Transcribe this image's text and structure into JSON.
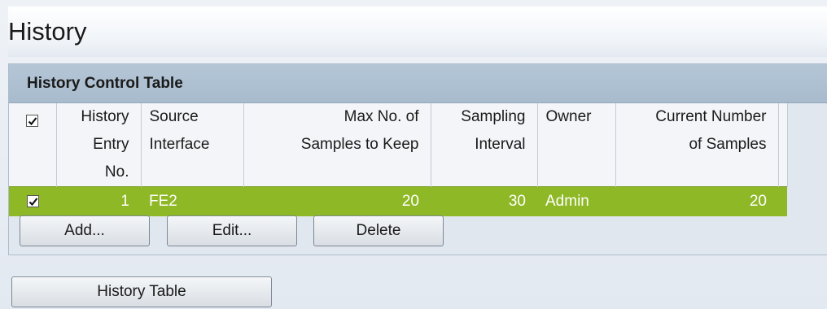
{
  "page": {
    "title": "History"
  },
  "panel": {
    "title": "History Control Table",
    "columns": [
      {
        "line1": "History",
        "line2": "Entry No."
      },
      {
        "line1": "Source",
        "line2": "Interface"
      },
      {
        "line1": "Max No. of",
        "line2": "Samples to Keep"
      },
      {
        "line1": "Sampling",
        "line2": "Interval"
      },
      {
        "line1": "Owner",
        "line2": ""
      },
      {
        "line1": "Current Number",
        "line2": "of Samples"
      }
    ],
    "header_checked": true,
    "rows": [
      {
        "checked": true,
        "entry_no": "1",
        "source_interface": "FE2",
        "max_samples": "20",
        "sampling_interval": "30",
        "owner": "Admin",
        "current_samples": "20"
      }
    ],
    "buttons": {
      "add": "Add...",
      "edit": "Edit...",
      "delete": "Delete"
    }
  },
  "history_table_button": "History Table",
  "colors": {
    "selected_row": "#8eb826",
    "header": "#a8bbcd"
  }
}
